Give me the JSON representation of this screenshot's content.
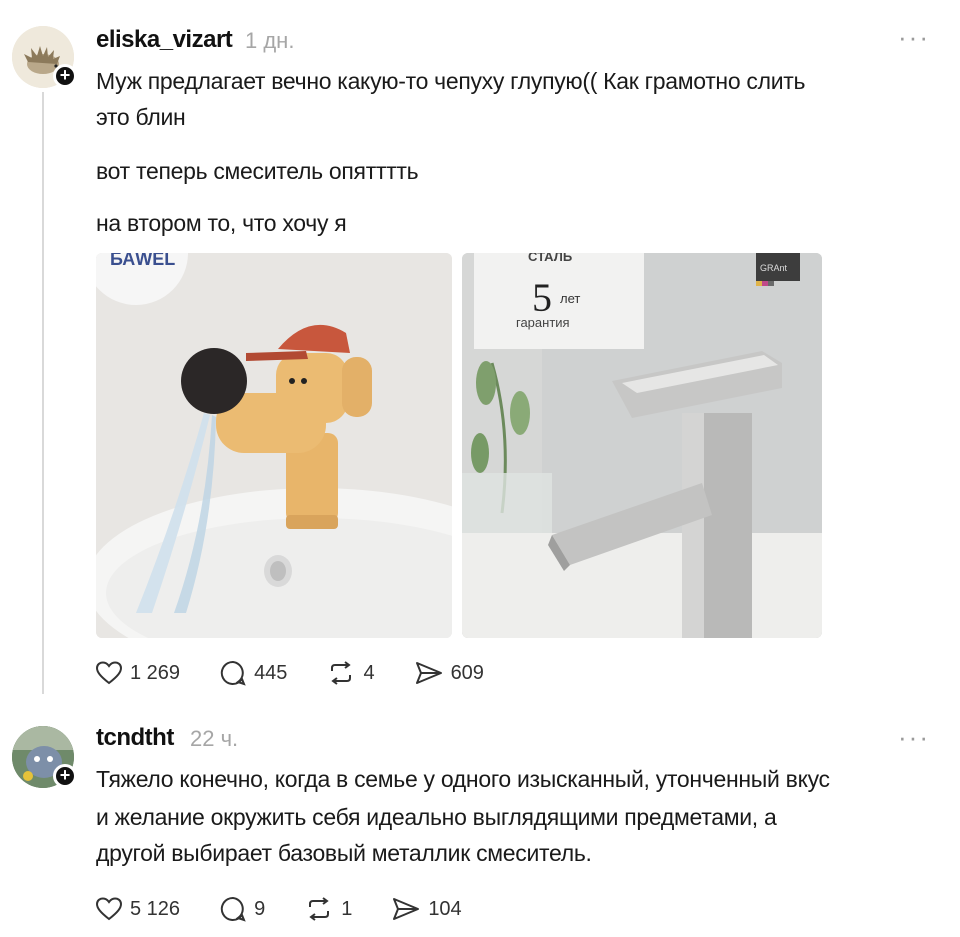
{
  "post1": {
    "username": "eliska_vizart",
    "time": "1 дн.",
    "more": "···",
    "lines": [
      "Муж предлагает вечно какую-то чепуху глупую(( Как грамотно слить",
      "это блин",
      "вот теперь смеситель опятттть",
      "на втором то, что хочу я"
    ],
    "image_left": {
      "brand_text": "БАWЕL",
      "icon": "cartoon-faucet-image"
    },
    "image_right": {
      "top_text": "СТАЛЬ",
      "warranty_number": "5",
      "warranty_unit": "лет",
      "warranty_label": "гарантия",
      "logo_text": "GRAnt",
      "icon": "steel-faucet-image"
    },
    "stats": {
      "likes": "1 269",
      "comments": "445",
      "reposts": "4",
      "shares": "609"
    }
  },
  "post2": {
    "username": "tcndtht",
    "time": "22 ч.",
    "more": "···",
    "lines": [
      "Тяжело конечно, когда в семье у одного изысканный, утонченный вкус",
      "и желание окружить себя идеально выглядящими предметами, а",
      "другой выбирает базовый металлик смеситель."
    ],
    "stats": {
      "likes": "5 126",
      "comments": "9",
      "reposts": "1",
      "shares": "104"
    }
  },
  "icons": {
    "like": "heart-icon",
    "comment": "comment-bubble-icon",
    "repost": "repost-arrows-icon",
    "share": "send-icon",
    "follow": "plus-icon"
  }
}
